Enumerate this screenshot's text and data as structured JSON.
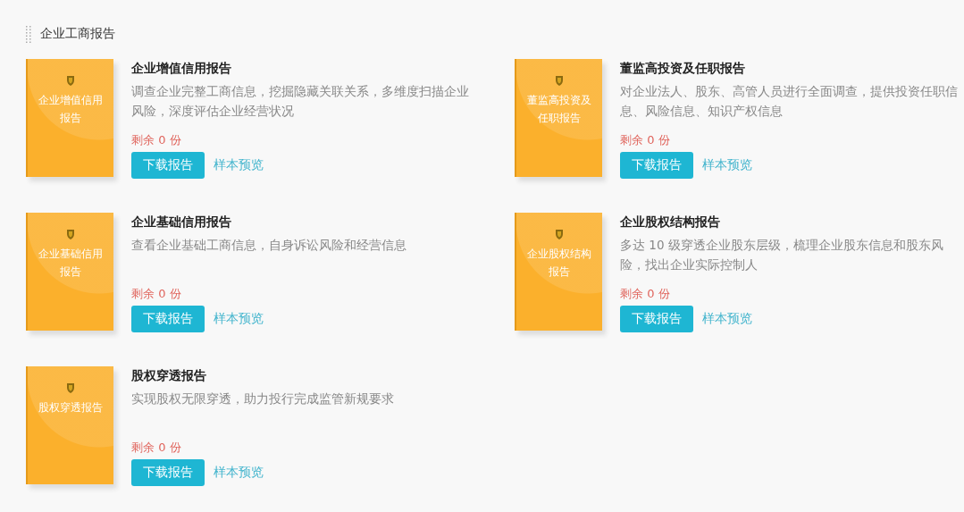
{
  "section": {
    "title": "企业工商报告"
  },
  "reports": [
    {
      "cover_title": "企业增值信用报告",
      "title": "企业增值信用报告",
      "description": "调查企业完整工商信息，挖掘隐藏关联关系，多维度扫描企业风险，深度评估企业经营状况",
      "remaining": "剩余 0 份",
      "download": "下载报告",
      "preview": "样本预览"
    },
    {
      "cover_title": "董监高投资及任职报告",
      "title": "董监高投资及任职报告",
      "description": "对企业法人、股东、高管人员进行全面调查，提供投资任职信息、风险信息、知识产权信息",
      "remaining": "剩余 0 份",
      "download": "下载报告",
      "preview": "样本预览"
    },
    {
      "cover_title": "企业基础信用报告",
      "title": "企业基础信用报告",
      "description": "查看企业基础工商信息，自身诉讼风险和经营信息",
      "remaining": "剩余 0 份",
      "download": "下载报告",
      "preview": "样本预览"
    },
    {
      "cover_title": "企业股权结构报告",
      "title": "企业股权结构报告",
      "description": "多达 10 级穿透企业股东层级，梳理企业股东信息和股东风险，找出企业实际控制人",
      "remaining": "剩余 0 份",
      "download": "下载报告",
      "preview": "样本预览"
    },
    {
      "cover_title": "股权穿透报告",
      "title": "股权穿透报告",
      "description": "实现股权无限穿透，助力投行完成监管新规要求",
      "remaining": "剩余 0 份",
      "download": "下载报告",
      "preview": "样本预览"
    }
  ]
}
